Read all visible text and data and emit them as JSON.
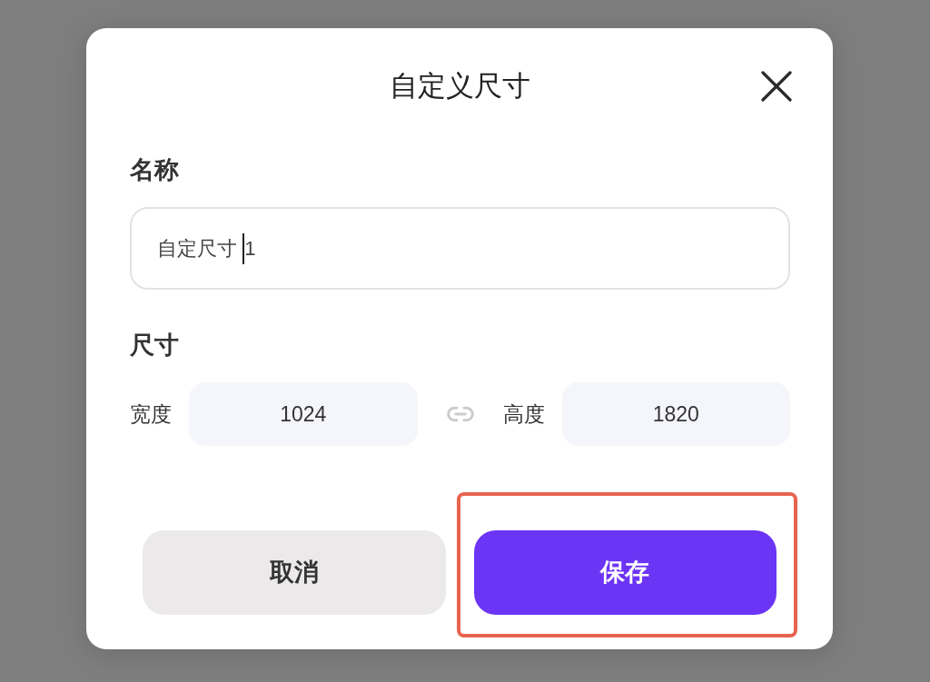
{
  "dialog": {
    "title": "自定义尺寸",
    "name_section": {
      "label": "名称",
      "input": {
        "value": "自定尺寸 1",
        "focused": true
      }
    },
    "size_section": {
      "label": "尺寸",
      "width": {
        "label": "宽度",
        "value": "1024"
      },
      "height": {
        "label": "高度",
        "value": "1820"
      }
    },
    "buttons": [
      {
        "label": "取消",
        "kind": "secondary",
        "highlighted": false
      },
      {
        "label": "保存",
        "kind": "primary",
        "highlighted": true
      }
    ]
  }
}
